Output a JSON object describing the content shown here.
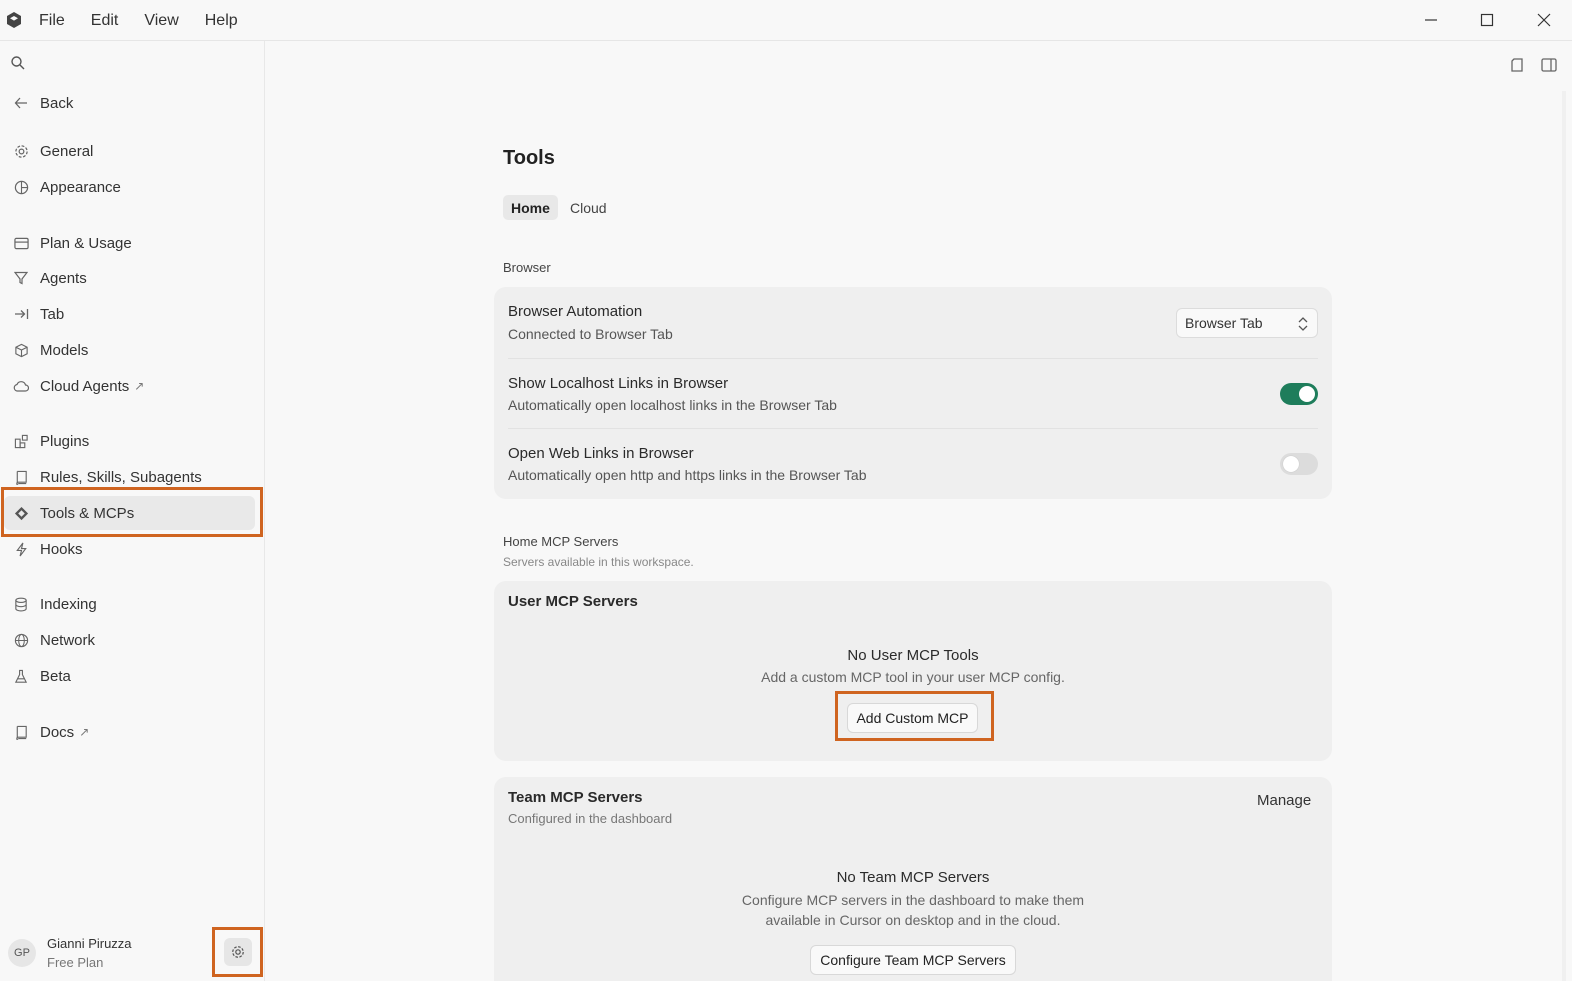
{
  "titlebar": {
    "menu": [
      "File",
      "Edit",
      "View",
      "Help"
    ]
  },
  "sidebar": {
    "back_label": "Back",
    "items": [
      {
        "label": "General",
        "icon": "gear-icon"
      },
      {
        "label": "Appearance",
        "icon": "palette-icon"
      },
      {
        "label": "Plan & Usage",
        "icon": "card-icon"
      },
      {
        "label": "Agents",
        "icon": "funnel-icon"
      },
      {
        "label": "Tab",
        "icon": "tab-arrow-icon"
      },
      {
        "label": "Models",
        "icon": "cube-icon"
      },
      {
        "label": "Cloud Agents",
        "icon": "cloud-icon",
        "external": "↗"
      },
      {
        "label": "Plugins",
        "icon": "puzzle-icon"
      },
      {
        "label": "Rules, Skills, Subagents",
        "icon": "book-icon"
      },
      {
        "label": "Tools & MCPs",
        "icon": "tools-icon",
        "active": true
      },
      {
        "label": "Hooks",
        "icon": "bolt-icon"
      },
      {
        "label": "Indexing",
        "icon": "database-icon"
      },
      {
        "label": "Network",
        "icon": "globe-icon"
      },
      {
        "label": "Beta",
        "icon": "flask-icon"
      },
      {
        "label": "Docs",
        "icon": "doc-icon",
        "external": "↗"
      }
    ],
    "user": {
      "initials": "GP",
      "name": "Gianni Piruzza",
      "plan": "Free Plan"
    }
  },
  "main": {
    "title": "Tools",
    "tabs": [
      {
        "label": "Home",
        "selected": true
      },
      {
        "label": "Cloud",
        "selected": false
      }
    ],
    "browser_section": {
      "label": "Browser",
      "rows": [
        {
          "title": "Browser Automation",
          "desc": "Connected to Browser Tab",
          "control": "select",
          "value": "Browser Tab"
        },
        {
          "title": "Show Localhost Links in Browser",
          "desc": "Automatically open localhost links in the Browser Tab",
          "control": "toggle",
          "on": true
        },
        {
          "title": "Open Web Links in Browser",
          "desc": "Automatically open http and https links in the Browser Tab",
          "control": "toggle",
          "on": false
        }
      ]
    },
    "mcp_section": {
      "label": "Home MCP Servers",
      "sub": "Servers available in this workspace."
    },
    "user_mcp": {
      "title": "User MCP Servers",
      "empty_title": "No User MCP Tools",
      "empty_desc": "Add a custom MCP tool in your user MCP config.",
      "button": "Add Custom MCP"
    },
    "team_mcp": {
      "title": "Team MCP Servers",
      "sub": "Configured in the dashboard",
      "manage": "Manage",
      "empty_title": "No Team MCP Servers",
      "empty_desc_1": "Configure MCP servers in the dashboard to make them",
      "empty_desc_2": "available in Cursor on desktop and in the cloud.",
      "button": "Configure Team MCP Servers"
    }
  },
  "colors": {
    "accent_toggle": "#1e7d5b",
    "highlight": "#cf6420"
  }
}
